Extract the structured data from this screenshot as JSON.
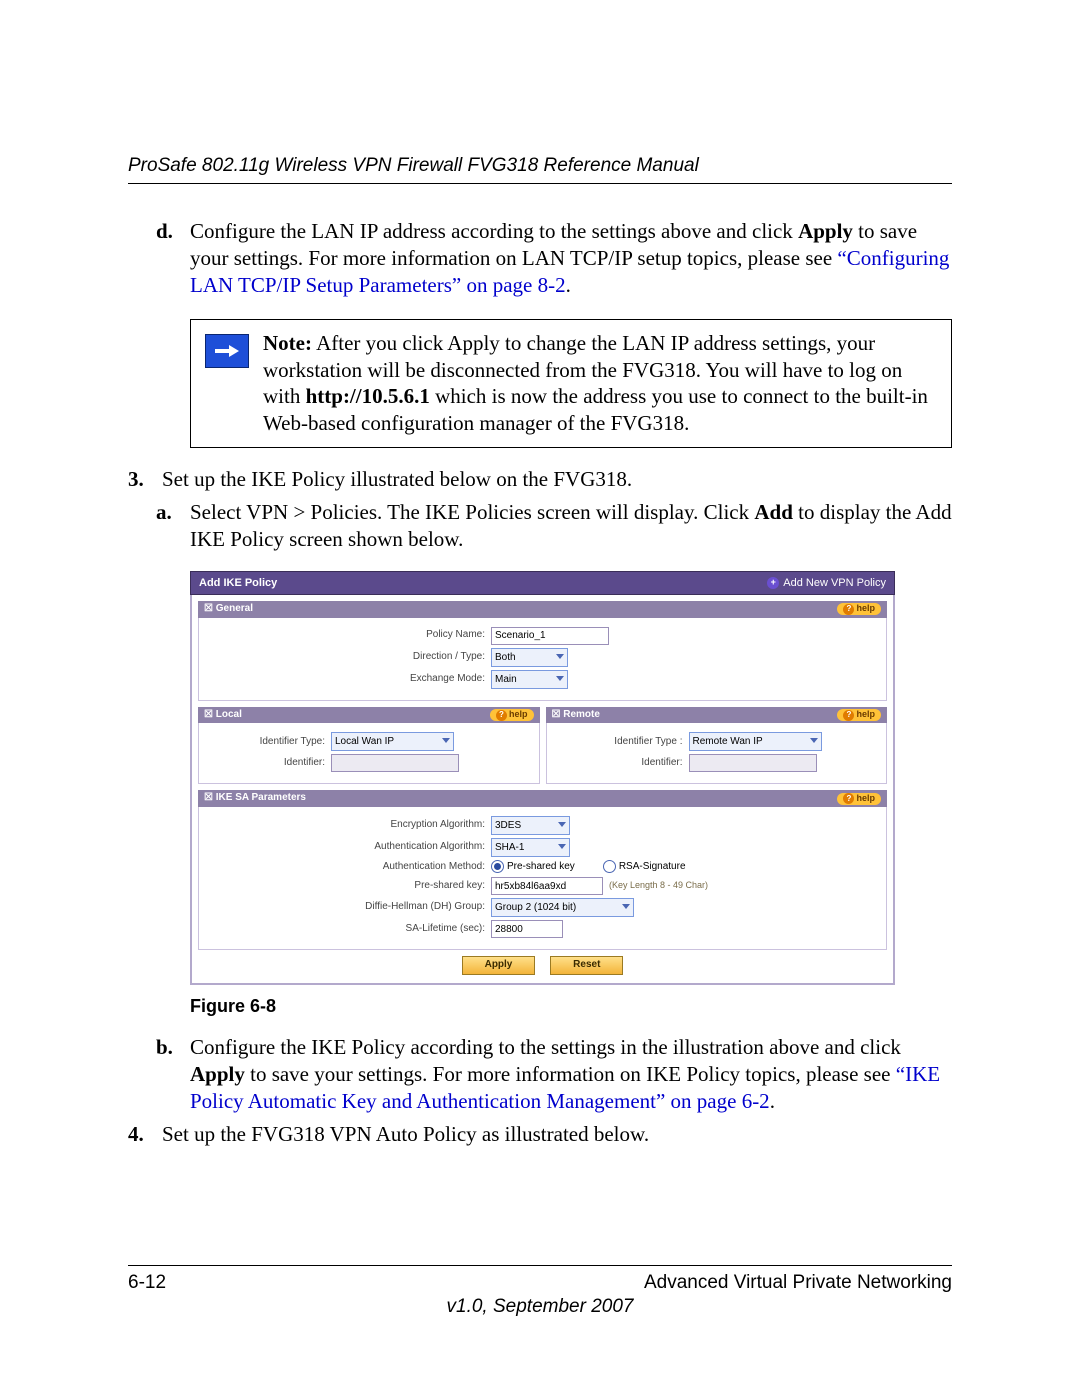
{
  "header": {
    "title": "ProSafe 802.11g Wireless VPN Firewall FVG318 Reference Manual"
  },
  "content": {
    "step_d_marker": "d.",
    "step_d_prefix": "Configure the LAN IP address according to the settings above and click ",
    "step_d_apply": "Apply",
    "step_d_mid": " to save your settings. For more information on LAN TCP/IP setup topics, please see ",
    "step_d_openq": "“",
    "step_d_link": "Configuring LAN TCP/IP Setup Parameters” on page 8-2",
    "step_d_end": ".",
    "note_label": "Note:",
    "note_text_1": " After you click Apply to change the LAN IP address settings, your workstation will be disconnected from the FVG318. You will have to log on with ",
    "note_bold": "http://10.5.6.1",
    "note_text_2": " which is now the address you use to connect to the built-in Web-based configuration manager of the FVG318.",
    "step_3_marker": "3.",
    "step_3_text": "Set up the IKE Policy illustrated below on the FVG318.",
    "step_3a_marker": "a.",
    "step_3a_prefix": "Select VPN > Policies. The IKE Policies screen will display. Click ",
    "step_3a_add": "Add",
    "step_3a_suffix": " to display the Add IKE Policy screen shown below.",
    "fig_caption": "Figure 6-8",
    "step_3b_marker": "b.",
    "step_3b_prefix": "Configure the IKE Policy according to the settings in the illustration above and click ",
    "step_3b_apply": "Apply",
    "step_3b_mid": " to save your settings. For more information on IKE Policy topics, please see ",
    "step_3b_openq": "“",
    "step_3b_link": "IKE Policy Automatic Key and Authentication Management” on page 6-2",
    "step_3b_end": ".",
    "step_4_marker": "4.",
    "step_4_text": "Set up the FVG318 VPN Auto Policy as illustrated below."
  },
  "ui": {
    "titlebar": "Add IKE Policy",
    "titlebar_link": "Add New VPN Policy",
    "help": "help",
    "sections": {
      "general": "General",
      "local": "Local",
      "remote": "Remote",
      "sa": "IKE SA Parameters"
    },
    "labels": {
      "policy_name": "Policy Name:",
      "direction": "Direction / Type:",
      "exchange": "Exchange Mode:",
      "id_type": "Identifier Type:",
      "id_type_r": "Identifier Type :",
      "identifier": "Identifier:",
      "enc_alg": "Encryption Algorithm:",
      "auth_alg": "Authentication Algorithm:",
      "auth_method": "Authentication Method:",
      "psk": "Pre-shared key:",
      "dh_group": "Diffie-Hellman (DH) Group:",
      "sa_life": "SA-Lifetime (sec):"
    },
    "values": {
      "policy_name": "Scenario_1",
      "direction": "Both",
      "exchange": "Main",
      "local_id_type": "Local Wan IP",
      "local_identifier": "",
      "remote_id_type": "Remote Wan IP",
      "remote_identifier": "",
      "enc_alg": "3DES",
      "auth_alg": "SHA-1",
      "radio_psk": "Pre-shared key",
      "radio_rsa": "RSA-Signature",
      "psk": "hr5xb84l6aa9xd",
      "key_length_hint": "(Key Length 8 - 49 Char)",
      "dh_group": "Group 2 (1024 bit)",
      "sa_life": "28800"
    },
    "buttons": {
      "apply": "Apply",
      "reset": "Reset"
    }
  },
  "footer": {
    "page_num": "6-12",
    "section": "Advanced Virtual Private Networking",
    "version": "v1.0, September 2007"
  }
}
